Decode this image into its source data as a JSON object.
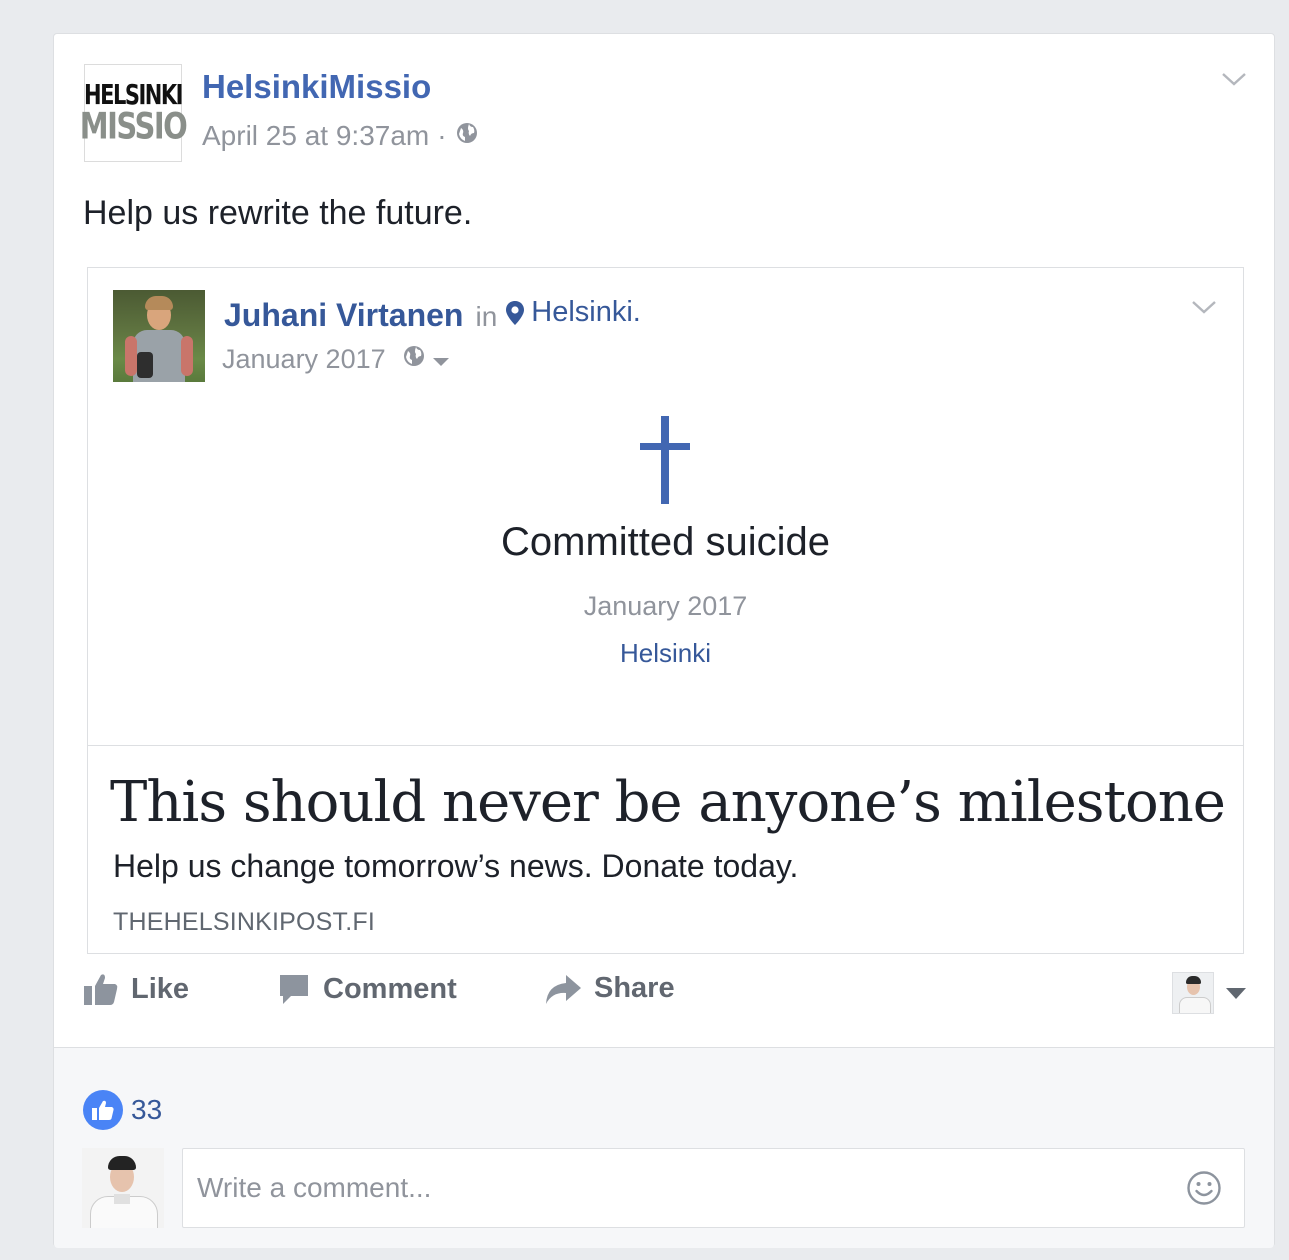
{
  "post": {
    "logo_line1": "HELSINKI",
    "logo_line2": "MISSIO",
    "page_name": "HelsinkiMissio",
    "timestamp": "April 25 at 9:37am",
    "separator": "·",
    "privacy_icon": "globe-icon",
    "menu_icon": "chevron-down-icon",
    "text": "Help us rewrite the future."
  },
  "shared": {
    "author": "Juhani Virtanen",
    "in_word": "in",
    "location_icon": "map-pin-icon",
    "location": "Helsinki.",
    "date": "January 2017",
    "milestone_icon": "cross-icon",
    "milestone_title": "Committed suicide",
    "milestone_date": "January 2017",
    "milestone_location": "Helsinki",
    "link_headline": "This should never be anyone’s milestone",
    "link_description": "Help us change tomorrow’s news. Donate today.",
    "link_domain": "THEHELSINKIPOST.FI"
  },
  "actions": {
    "like_label": "Like",
    "comment_label": "Comment",
    "share_label": "Share"
  },
  "footer": {
    "like_count": "33",
    "comment_placeholder": "Write a comment..."
  },
  "colors": {
    "link_blue": "#4267b2",
    "meta_gray": "#90949c",
    "like_blue": "#4a84f6",
    "page_bg": "#e9ebee"
  }
}
